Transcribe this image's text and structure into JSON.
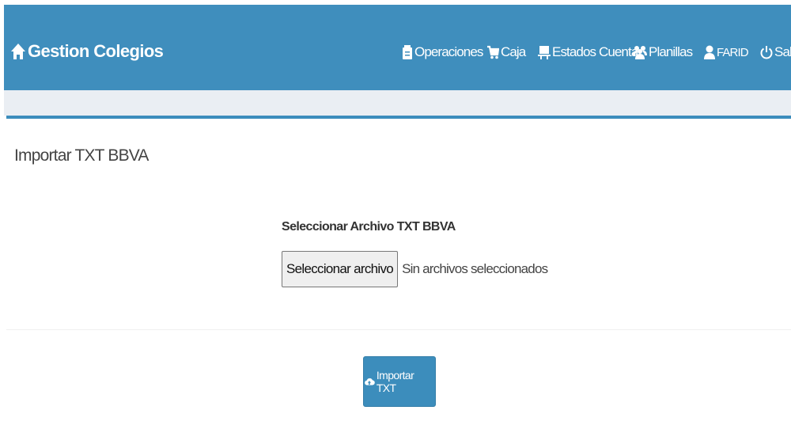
{
  "brand": {
    "name": "Gestion Colegios",
    "icon": "home-icon"
  },
  "nav": [
    {
      "label": "Operaciones",
      "icon": "clipboard-icon"
    },
    {
      "label": "Caja",
      "icon": "cart-icon"
    },
    {
      "label": "Estados Cuenta",
      "icon": "blackboard-icon"
    },
    {
      "label": "Planillas",
      "icon": "users-icon"
    },
    {
      "label": "FARID",
      "icon": "user-icon"
    },
    {
      "label": "Salir",
      "icon": "power-icon"
    }
  ],
  "card": {
    "title": "Importar TXT BBVA",
    "field_label": "Seleccionar Archivo TXT BBVA",
    "file_button": "Seleccionar archivo",
    "file_status": "Sin archivos seleccionados",
    "submit": {
      "label": "Importar TXT",
      "icon": "cloud-upload-icon"
    }
  },
  "colors": {
    "navbar": "#3f8ebd",
    "accent": "#3c8dbc",
    "band": "#eaeef3"
  }
}
